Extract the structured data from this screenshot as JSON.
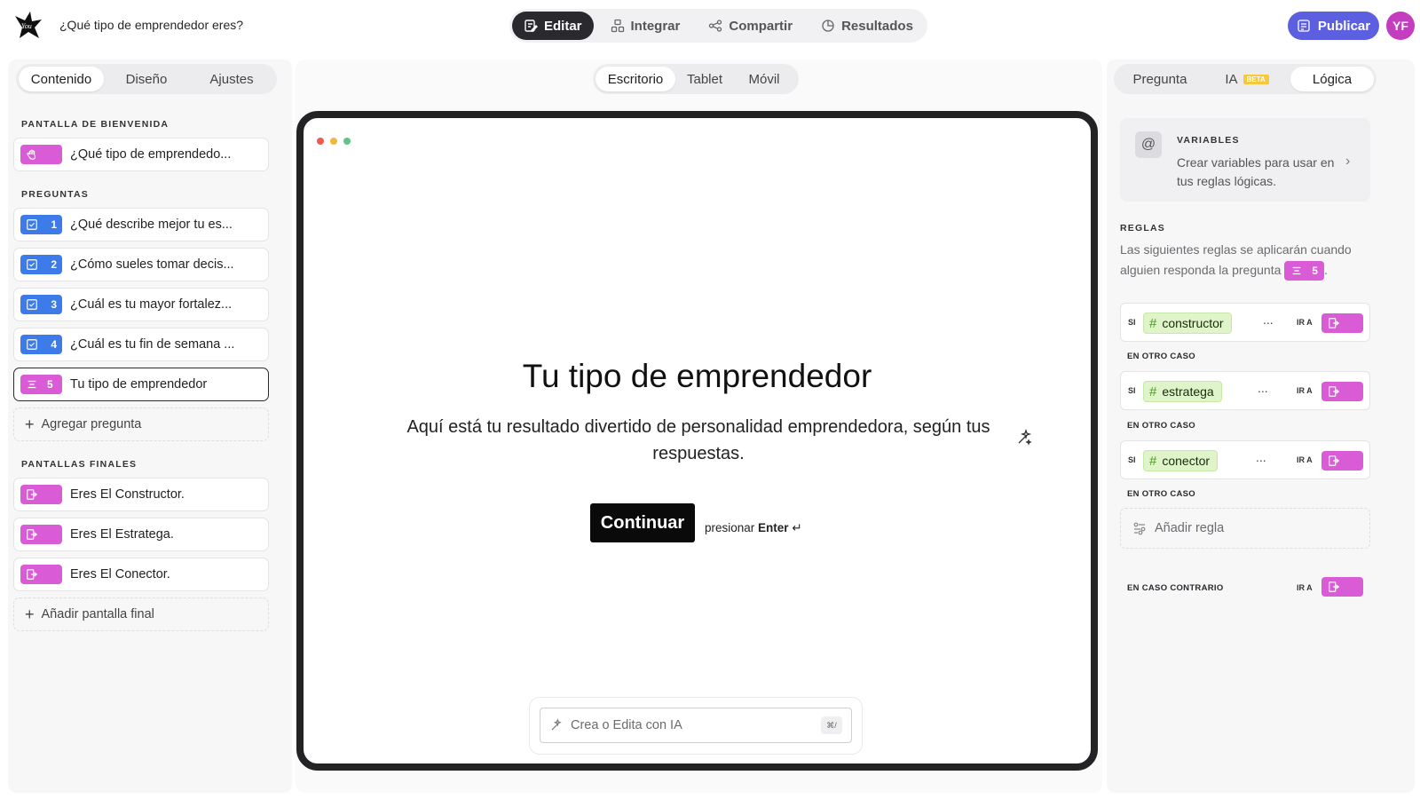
{
  "app": {
    "form_title": "¿Qué tipo de emprendedor eres?",
    "logo_icon": "brand-logo-icon",
    "avatar_initials": "YF",
    "avatar_color": "#c43dbf"
  },
  "top_tabs": [
    {
      "label": "Editar",
      "icon": "edit-icon",
      "active": true
    },
    {
      "label": "Integrar",
      "icon": "integrate-icon",
      "active": false
    },
    {
      "label": "Compartir",
      "icon": "share-icon",
      "active": false
    },
    {
      "label": "Resultados",
      "icon": "results-icon",
      "active": false
    }
  ],
  "publish": {
    "label": "Publicar",
    "icon": "publish-icon",
    "color": "#5b5fe0"
  },
  "left_panel": {
    "tabs": [
      "Contenido",
      "Diseño",
      "Ajustes"
    ],
    "active_tab": "Contenido",
    "welcome_section": "PANTALLA DE BIENVENIDA",
    "welcome_item": {
      "label": "¿Qué tipo de emprendedo...",
      "icon": "hand-wave-icon"
    },
    "questions_section": "PREGUNTAS",
    "questions": [
      {
        "number": "1",
        "label": "¿Qué describe mejor tu es...",
        "icon": "checkbox-icon"
      },
      {
        "number": "2",
        "label": "¿Cómo sueles tomar decis...",
        "icon": "checkbox-icon"
      },
      {
        "number": "3",
        "label": "¿Cuál es tu mayor fortalez...",
        "icon": "checkbox-icon"
      },
      {
        "number": "4",
        "label": "¿Cuál es tu fin de semana ...",
        "icon": "checkbox-icon"
      },
      {
        "number": "5",
        "label": "Tu tipo de emprendedor",
        "icon": "text-lines-icon"
      }
    ],
    "add_question": "Agregar pregunta",
    "endings_section": "PANTALLAS FINALES",
    "endings": [
      {
        "label": "Eres El Constructor.",
        "icon": "exit-icon"
      },
      {
        "label": "Eres El Estratega.",
        "icon": "exit-icon"
      },
      {
        "label": "Eres El Conector.",
        "icon": "exit-icon"
      }
    ],
    "add_ending": "Añadir pantalla final"
  },
  "center": {
    "device_tabs": [
      "Escritorio",
      "Tablet",
      "Móvil"
    ],
    "active_device": "Escritorio",
    "preview": {
      "title": "Tu tipo de emprendedor",
      "description": "Aquí está tu resultado divertido de personalidad emprendedora, según tus respuestas.",
      "button": "Continuar",
      "hint_prefix": "presionar",
      "hint_key": "Enter",
      "hint_symbol": "↵"
    },
    "ai_input": {
      "placeholder": "Crea o Edita con IA",
      "shortcut": "⌘/"
    }
  },
  "right_panel": {
    "tabs": [
      "Pregunta",
      "IA",
      "Lógica"
    ],
    "beta_badge": "BETA",
    "active_tab": "Lógica",
    "variables": {
      "title": "VARIABLES",
      "description": "Crear variables para usar en tus reglas lógicas.",
      "icon": "at-icon"
    },
    "rules_section": "REGLAS",
    "rules_description": "Las siguientes reglas se aplicarán cuando alguien responda la pregunta",
    "rules_question_number": "5",
    "rules_description_end": ".",
    "rules": [
      {
        "if_label": "SI",
        "tag": "constructor",
        "more": "...",
        "goto_label": "IR A"
      },
      {
        "if_label": "SI",
        "tag": "estratega",
        "more": "...",
        "goto_label": "IR A"
      },
      {
        "if_label": "SI",
        "tag": "conector",
        "more": "...",
        "goto_label": "IR A"
      }
    ],
    "else_label": "EN OTRO CASO",
    "add_rule": "Añadir regla",
    "otherwise_label": "EN CASO CONTRARIO",
    "otherwise_goto": "IR A"
  }
}
